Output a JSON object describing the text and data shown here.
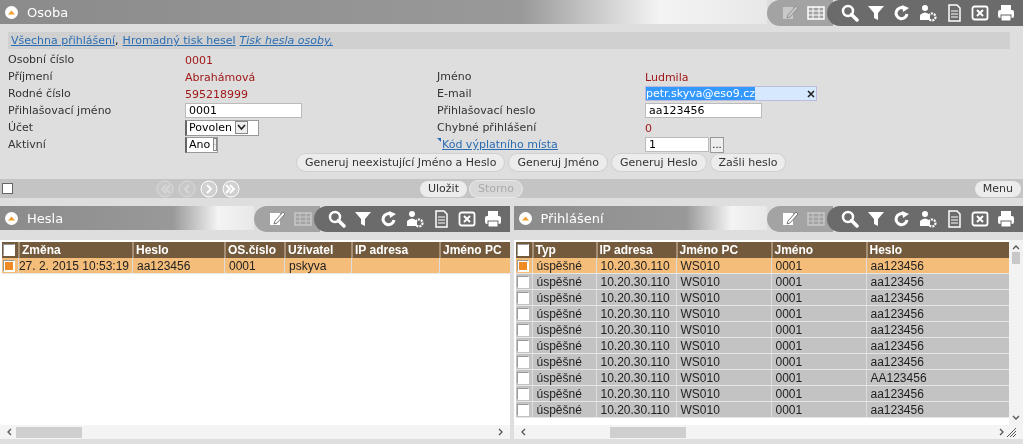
{
  "main_panel": {
    "title": "Osoba",
    "toolbar": [
      {
        "icons": [
          {
            "kind": "edit",
            "disabled": true
          },
          {
            "kind": "table",
            "disabled": false
          }
        ]
      },
      {
        "icons": [
          {
            "kind": "search",
            "disabled": false
          },
          {
            "kind": "filter",
            "disabled": false
          },
          {
            "kind": "refresh",
            "disabled": false
          },
          {
            "kind": "user-settings",
            "disabled": false
          },
          {
            "kind": "document",
            "disabled": false
          },
          {
            "kind": "excel",
            "disabled": false
          },
          {
            "kind": "print",
            "disabled": false
          }
        ]
      }
    ]
  },
  "links": [
    {
      "text": "Všechna přihlášení",
      "italic": false,
      "suffix": ","
    },
    {
      "text": "Hromadný tisk hesel",
      "italic": false
    },
    {
      "text": "Tisk hesla osoby,",
      "italic": true
    }
  ],
  "form_rows": [
    {
      "left": {
        "label": "Osobní číslo",
        "kind": "value",
        "value": "0001"
      }
    },
    {
      "left": {
        "label": "Příjmení",
        "kind": "value",
        "value": "Abrahámová"
      },
      "right": {
        "label": "Jméno",
        "kind": "value",
        "value": "Ludmila"
      }
    },
    {
      "left": {
        "label": "Rodné číslo",
        "kind": "value",
        "value": "595218999"
      },
      "right": {
        "label": "E-mail",
        "kind": "clearable",
        "value": "petr.skyva@eso9.cz",
        "highlighted": true
      }
    },
    {
      "left": {
        "label": "Přihlašovací jméno",
        "kind": "input",
        "value": "0001"
      },
      "right": {
        "label": "Přihlašovací heslo",
        "kind": "input",
        "value": "aa123456"
      }
    },
    {
      "left": {
        "label": "Účet",
        "kind": "select",
        "value": "Povolen"
      },
      "right": {
        "label": "Chybné přihlášení",
        "kind": "value",
        "value": "0"
      }
    },
    {
      "left": {
        "label": "Aktivní",
        "kind": "select",
        "value": "Ano"
      },
      "right": {
        "label": "Kód výplatního místa",
        "kind": "lookup",
        "value": "1",
        "button": "..."
      }
    }
  ],
  "buttons": [
    {
      "label": "Generuj neexistující Jméno a Heslo"
    },
    {
      "label": "Generuj Jméno"
    },
    {
      "label": "Generuj Heslo"
    },
    {
      "label": "Zašli heslo"
    }
  ],
  "nav": {
    "checked": false,
    "arrows": [
      {
        "kind": "first",
        "disabled": true
      },
      {
        "kind": "prev",
        "disabled": true
      },
      {
        "kind": "next",
        "disabled": false
      },
      {
        "kind": "last",
        "disabled": false
      }
    ],
    "actions": [
      {
        "label": "Uložit",
        "disabled": false
      },
      {
        "label": "Storno",
        "disabled": true
      }
    ],
    "menu": "Menu"
  },
  "hesla": {
    "title": "Hesla",
    "toolbar": [
      {
        "icons": [
          {
            "kind": "edit",
            "disabled": false
          },
          {
            "kind": "table",
            "disabled": true
          }
        ]
      },
      {
        "icons": [
          {
            "kind": "search",
            "disabled": false
          },
          {
            "kind": "filter",
            "disabled": false
          },
          {
            "kind": "refresh",
            "disabled": false
          },
          {
            "kind": "user-settings",
            "disabled": false
          },
          {
            "kind": "document",
            "disabled": false
          },
          {
            "kind": "excel",
            "disabled": false
          },
          {
            "kind": "print",
            "disabled": false
          }
        ]
      }
    ],
    "all_selected": false,
    "columns": [
      "Změna",
      "Heslo",
      "OS.číslo",
      "Uživatel",
      "IP adresa",
      "Jméno PC"
    ],
    "rows": [
      {
        "selected": true,
        "cells": [
          "27. 2. 2015 10:53:19",
          "aa123456",
          "0001",
          "pskyva",
          "",
          ""
        ]
      }
    ]
  },
  "prihlaseni": {
    "title": "Přihlášení",
    "toolbar": [
      {
        "icons": [
          {
            "kind": "edit",
            "disabled": false
          },
          {
            "kind": "table",
            "disabled": true
          }
        ]
      },
      {
        "icons": [
          {
            "kind": "search",
            "disabled": false
          },
          {
            "kind": "filter",
            "disabled": false
          },
          {
            "kind": "refresh",
            "disabled": false
          },
          {
            "kind": "user-settings",
            "disabled": false
          },
          {
            "kind": "document",
            "disabled": false
          },
          {
            "kind": "excel",
            "disabled": false
          },
          {
            "kind": "print",
            "disabled": false
          }
        ]
      }
    ],
    "all_selected": false,
    "columns": [
      "Typ",
      "IP adresa",
      "Jméno PC",
      "Jméno",
      "Heslo"
    ],
    "rows": [
      {
        "selected": true,
        "cells": [
          "úspěšné",
          "10.20.30.110",
          "WS010",
          "0001",
          "aa123456"
        ]
      },
      {
        "selected": false,
        "cells": [
          "úspěšné",
          "10.20.30.110",
          "WS010",
          "0001",
          "aa123456"
        ]
      },
      {
        "selected": false,
        "cells": [
          "úspěšné",
          "10.20.30.110",
          "WS010",
          "0001",
          "aa123456"
        ]
      },
      {
        "selected": false,
        "cells": [
          "úspěšné",
          "10.20.30.110",
          "WS010",
          "0001",
          "aa123456"
        ]
      },
      {
        "selected": false,
        "cells": [
          "úspěšné",
          "10.20.30.110",
          "WS010",
          "0001",
          "aa123456"
        ]
      },
      {
        "selected": false,
        "cells": [
          "úspěšné",
          "10.20.30.110",
          "WS010",
          "0001",
          "aa123456"
        ]
      },
      {
        "selected": false,
        "cells": [
          "úspěšné",
          "10.20.30.110",
          "WS010",
          "0001",
          "aa123456"
        ]
      },
      {
        "selected": false,
        "cells": [
          "úspěšné",
          "10.20.30.110",
          "WS010",
          "0001",
          "AA123456"
        ]
      },
      {
        "selected": false,
        "cells": [
          "úspěšné",
          "10.20.30.110",
          "WS010",
          "0001",
          "aa123456"
        ]
      },
      {
        "selected": false,
        "cells": [
          "úspěšné",
          "10.20.30.110",
          "WS010",
          "0001",
          "aa123456"
        ]
      }
    ]
  }
}
